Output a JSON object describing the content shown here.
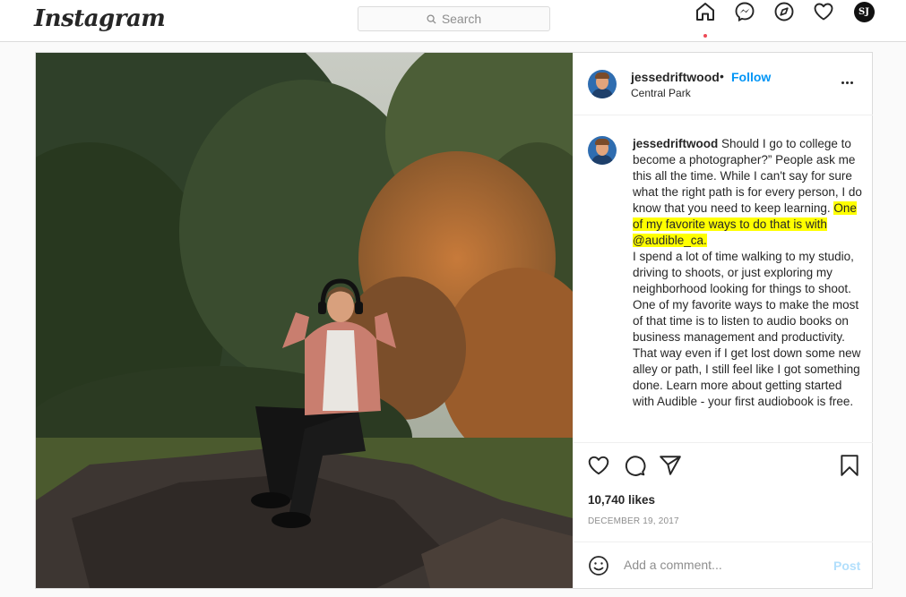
{
  "nav": {
    "logo": "Instagram",
    "search_placeholder": "Search",
    "profile_initials": "SJ",
    "icons": [
      "home-icon",
      "messenger-icon",
      "explore-icon",
      "activity-heart-icon",
      "profile-avatar"
    ]
  },
  "post": {
    "username": "jessedriftwood",
    "separator": "•",
    "follow_label": "Follow",
    "location": "Central Park",
    "caption_user": "jessedriftwood",
    "caption_part1": "Should I go to college to become a photographer?” People ask me this all the time. While I can't say for sure what the right path is for every person, I do know that you need to keep learning. ",
    "caption_highlight": "One of my favorite ways to do that is with @audible_ca.",
    "caption_part2": "I spend a lot of time walking to my studio, driving to shoots, or just exploring my neighborhood looking for things to shoot. One of my favorite ways to make the most of that time is to listen to audio books on business management and productivity. That way even if I get lost down some new alley or path, I still feel like I got something done. Learn more about getting started with Audible - your first audiobook is free.",
    "likes": "10,740 likes",
    "date": "DECEMBER 19, 2017",
    "comment_placeholder": "Add a comment...",
    "post_label": "Post"
  },
  "colors": {
    "accent_blue": "#0095f6",
    "post_disabled": "#b2dffc",
    "highlight": "#ffff00",
    "notification_dot": "#ed4956"
  }
}
